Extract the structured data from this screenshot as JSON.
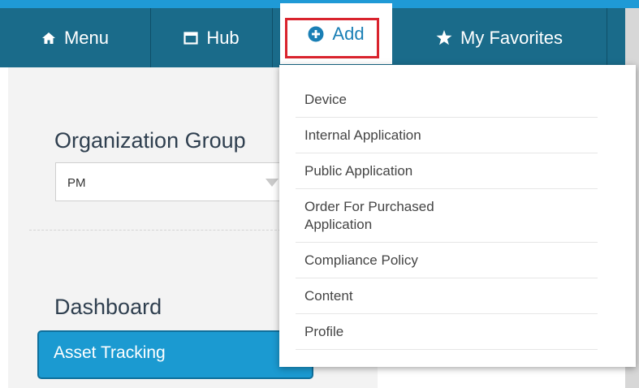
{
  "nav": {
    "menu_label": "Menu",
    "hub_label": "Hub",
    "add_label": "Add",
    "favorites_label": "My Favorites",
    "icons": {
      "menu": "home-icon",
      "hub": "window-icon",
      "add": "plus-circle-icon",
      "favorites": "star-icon"
    }
  },
  "sidebar": {
    "org_group_label": "Organization Group",
    "org_group_value": "PM",
    "dashboard_label": "Dashboard",
    "asset_tracking_label": "Asset Tracking"
  },
  "add_menu": {
    "items": [
      {
        "label": "Device"
      },
      {
        "label": "Internal Application"
      },
      {
        "label": "Public Application"
      },
      {
        "label": "Order For Purchased\nApplication"
      },
      {
        "label": "Compliance Policy"
      },
      {
        "label": "Content"
      },
      {
        "label": "Profile"
      }
    ]
  },
  "colors": {
    "nav_bg": "#1a6b8a",
    "accent": "#1f9ad6",
    "highlight": "#d9232d"
  }
}
